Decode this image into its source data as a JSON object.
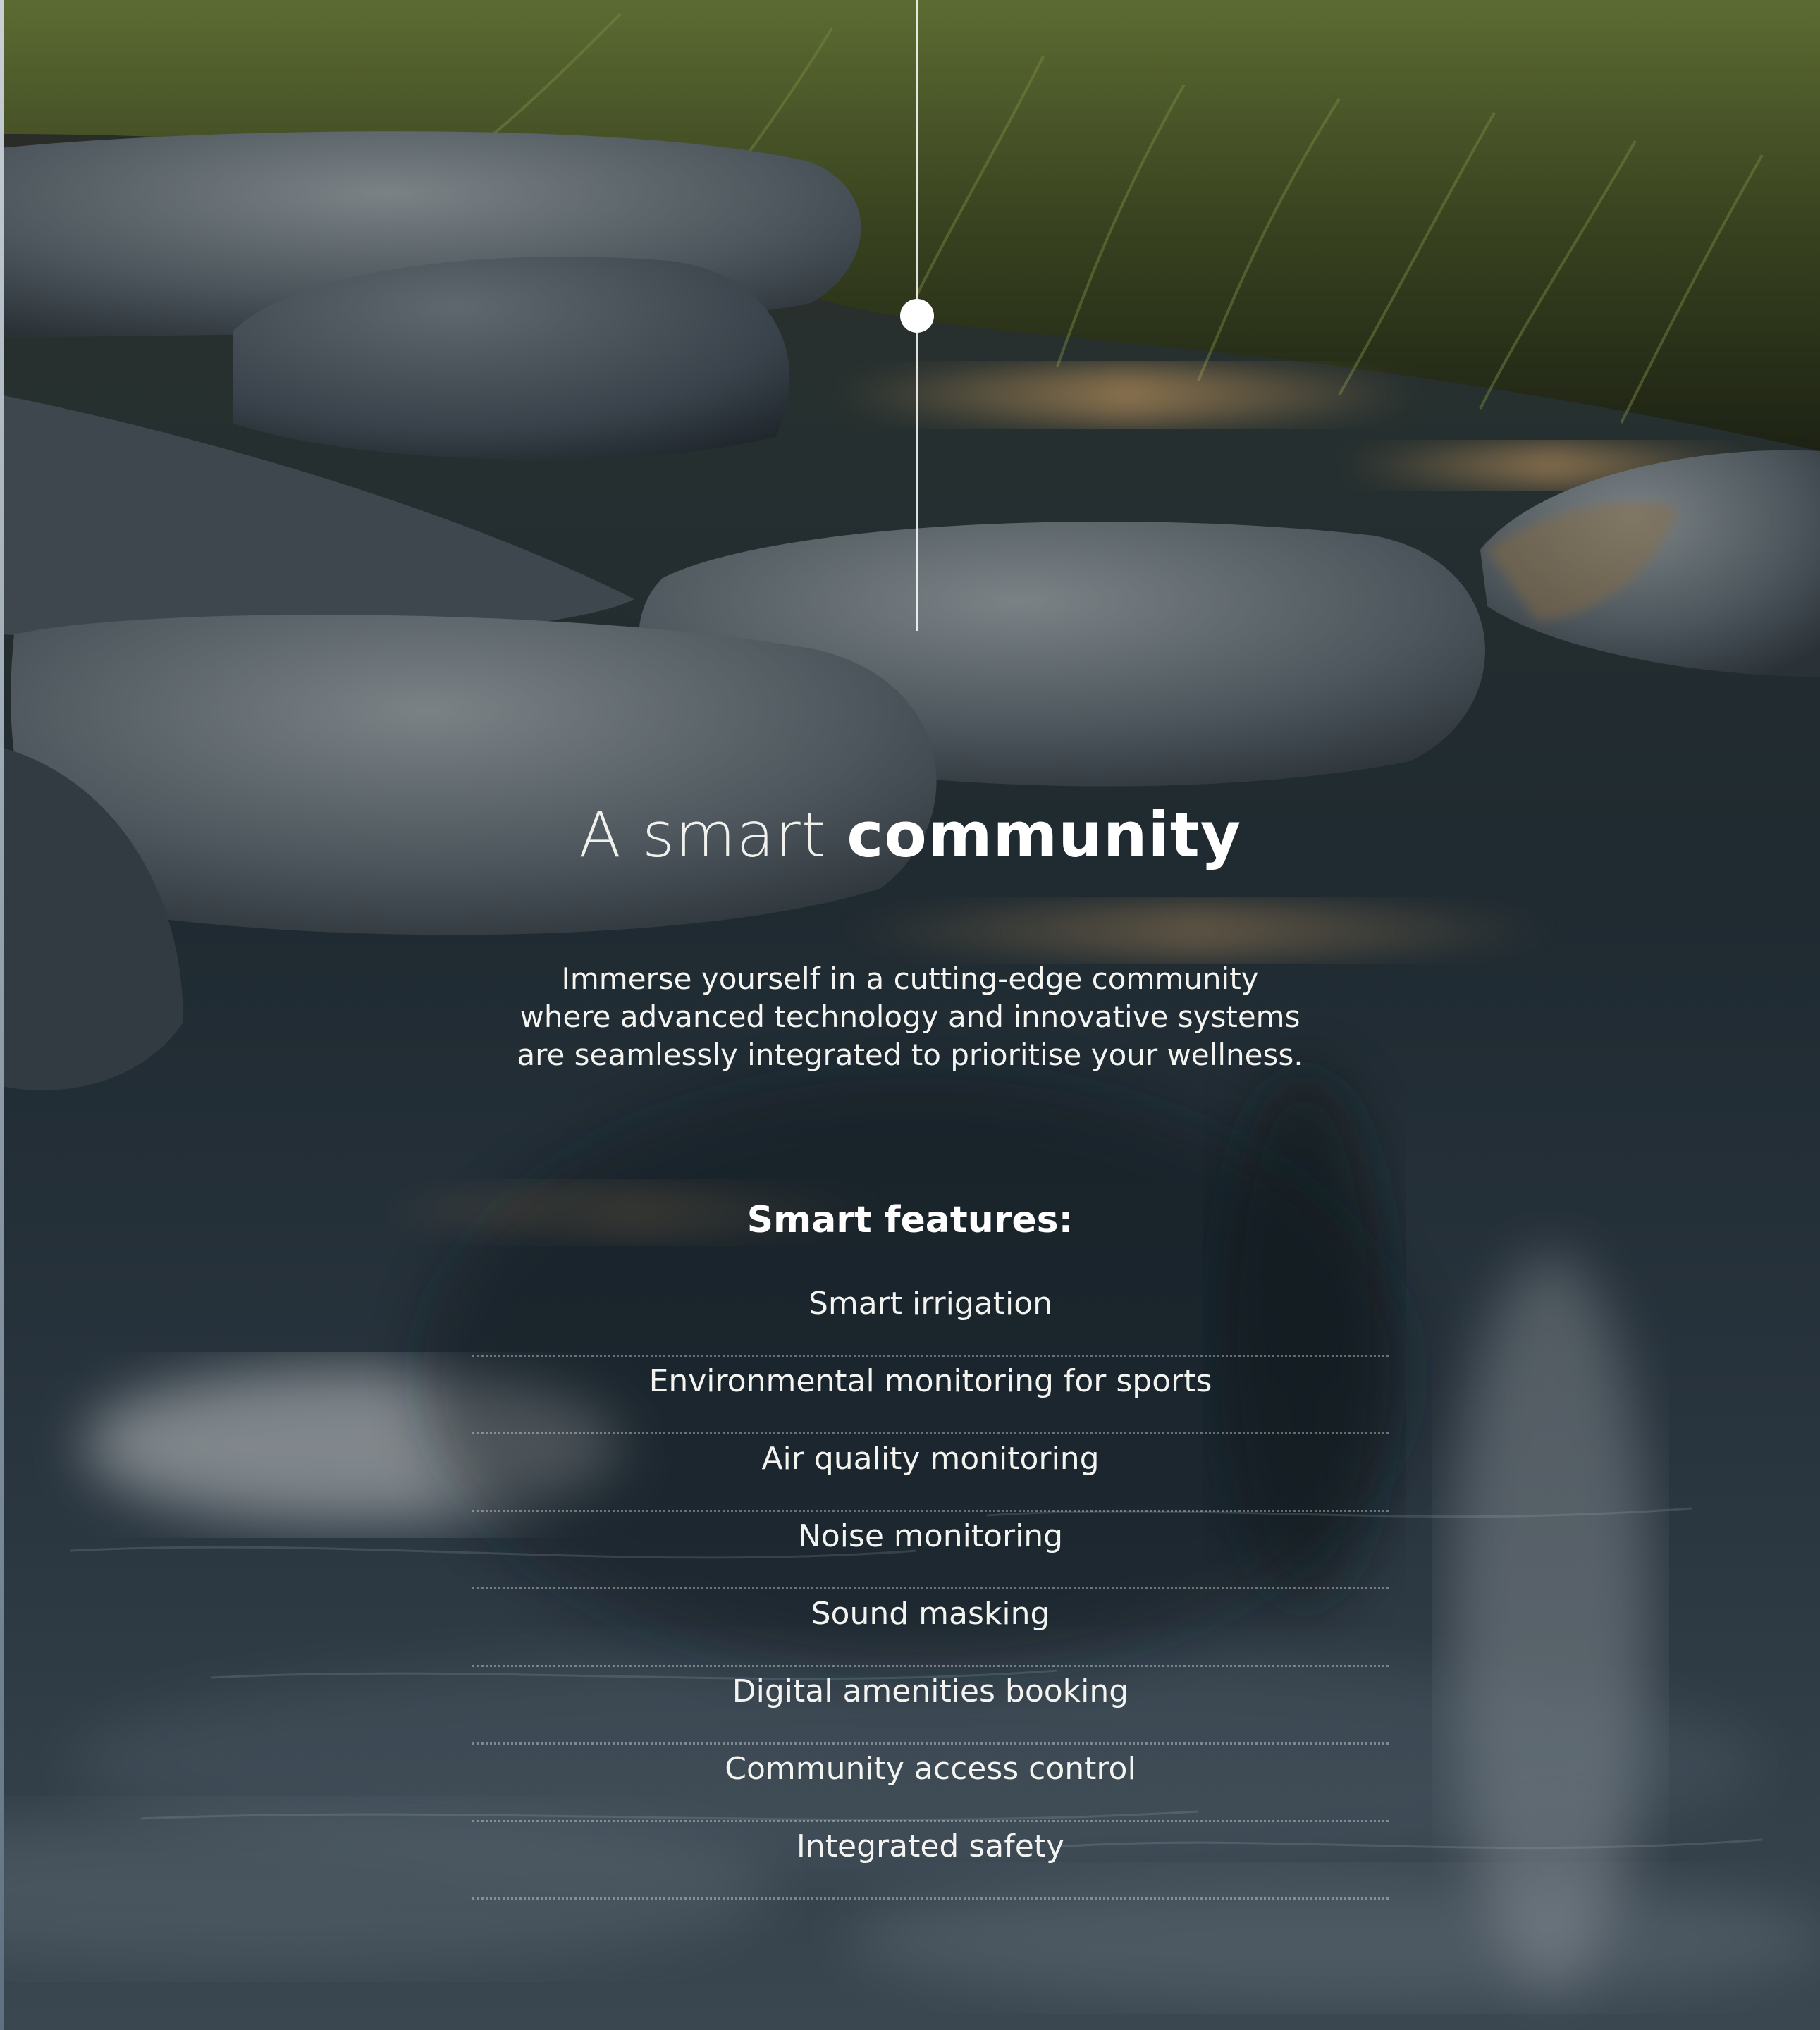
{
  "hero": {
    "title_light": "A smart",
    "title_bold": "community",
    "intro_lines": [
      "Immerse yourself in a cutting-edge community",
      "where advanced technology and innovative systems",
      "are seamlessly integrated to prioritise your wellness."
    ]
  },
  "features": {
    "heading": "Smart features:",
    "items": [
      "Smart irrigation",
      "Environmental monitoring for sports",
      "Air quality monitoring",
      "Noise monitoring",
      "Sound masking",
      "Digital amenities booking",
      "Community access control",
      "Integrated safety"
    ]
  },
  "colors": {
    "water": "#1d2830",
    "grass": "#3b4a24",
    "rock": "#4a5258",
    "text": "#f3f3ef"
  }
}
